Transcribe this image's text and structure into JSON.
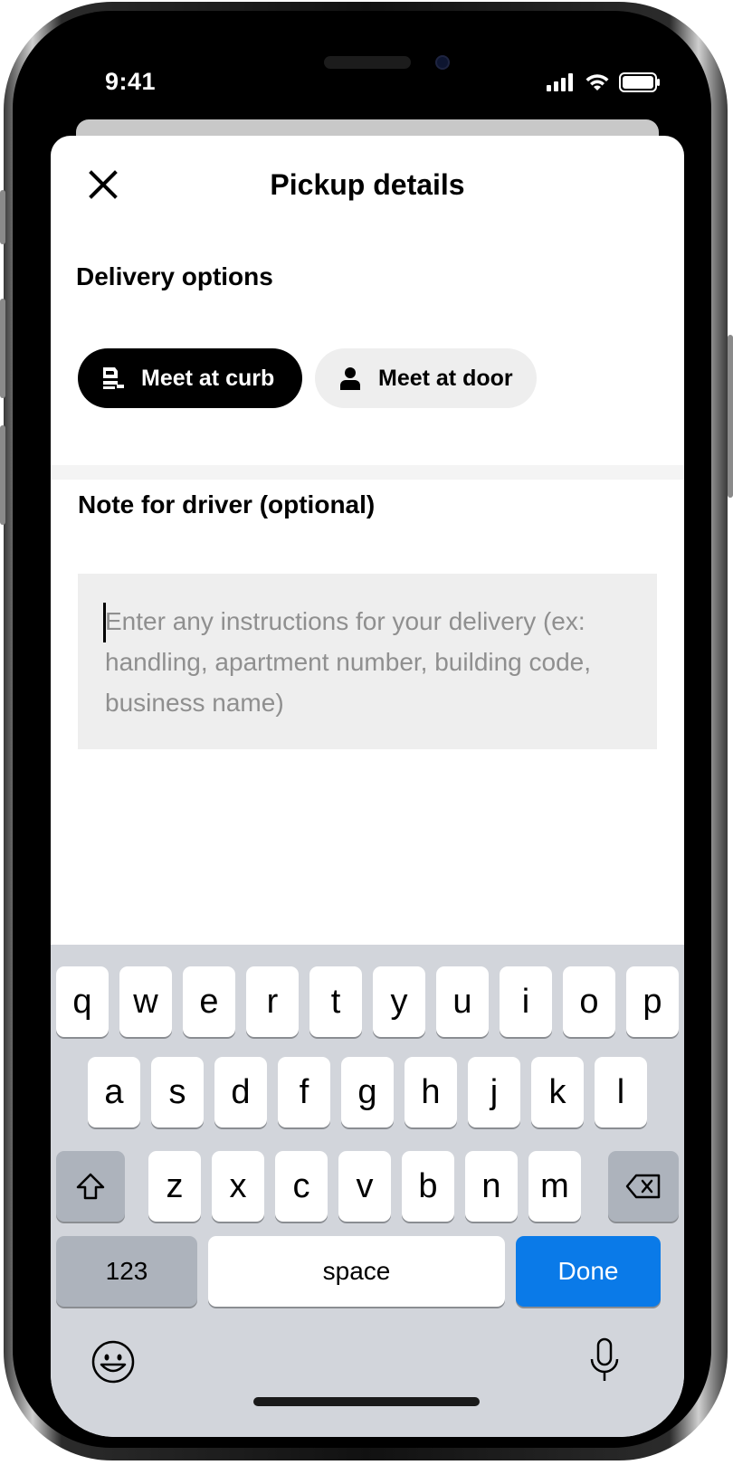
{
  "status_bar": {
    "time": "9:41"
  },
  "header": {
    "title": "Pickup details"
  },
  "delivery": {
    "label": "Delivery options",
    "options": [
      {
        "label": "Meet at curb",
        "selected": true
      },
      {
        "label": "Meet at door",
        "selected": false
      }
    ]
  },
  "note": {
    "label": "Note for driver (optional)",
    "placeholder": "Enter any instructions for your delivery (ex: handling, apartment number, building code, business name)"
  },
  "keyboard": {
    "row1": [
      "q",
      "w",
      "e",
      "r",
      "t",
      "y",
      "u",
      "i",
      "o",
      "p"
    ],
    "row2": [
      "a",
      "s",
      "d",
      "f",
      "g",
      "h",
      "j",
      "k",
      "l"
    ],
    "row3": [
      "z",
      "x",
      "c",
      "v",
      "b",
      "n",
      "m"
    ],
    "numbers_label": "123",
    "space_label": "space",
    "done_label": "Done"
  },
  "colors": {
    "accent": "#0a7ae8",
    "selected_pill": "#000000",
    "field_bg": "#eeeeee"
  }
}
